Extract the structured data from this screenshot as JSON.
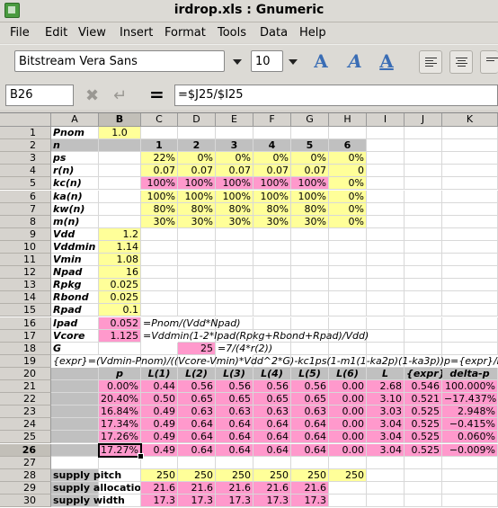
{
  "window": {
    "title": "irdrop.xls : Gnumeric"
  },
  "menu": [
    "File",
    "Edit",
    "View",
    "Insert",
    "Format",
    "Tools",
    "Data",
    "Help"
  ],
  "toolbar": {
    "font_name": "Bitstream Vera Sans",
    "font_size": "10"
  },
  "formula_bar": {
    "cell_ref": "B26",
    "equals": "=",
    "formula": "=$J25/$I25"
  },
  "columns": [
    "A",
    "B",
    "C",
    "D",
    "E",
    "F",
    "G",
    "H",
    "I",
    "J",
    "K"
  ],
  "rows": [
    "1",
    "2",
    "3",
    "4",
    "5",
    "6",
    "7",
    "8",
    "9",
    "10",
    "11",
    "12",
    "13",
    "14",
    "15",
    "16",
    "17",
    "18",
    "19",
    "20",
    "21",
    "22",
    "23",
    "24",
    "25",
    "26",
    "27",
    "28",
    "29",
    "30"
  ],
  "cells": {
    "r1": {
      "a": "Pnom",
      "b": "1.0"
    },
    "r2": {
      "a": "n",
      "c": "1",
      "d": "2",
      "e": "3",
      "f": "4",
      "g": "5",
      "h": "6"
    },
    "r3": {
      "a": "ps",
      "c": "22%",
      "d": "0%",
      "e": "0%",
      "f": "0%",
      "g": "0%",
      "h": "0%"
    },
    "r4": {
      "a": "r(n)",
      "c": "0.07",
      "d": "0.07",
      "e": "0.07",
      "f": "0.07",
      "g": "0.07",
      "h": "0"
    },
    "r5": {
      "a": "kc(n)",
      "c": "100%",
      "d": "100%",
      "e": "100%",
      "f": "100%",
      "g": "100%",
      "h": "0%"
    },
    "r6": {
      "a": "ka(n)",
      "c": "100%",
      "d": "100%",
      "e": "100%",
      "f": "100%",
      "g": "100%",
      "h": "0%"
    },
    "r7": {
      "a": "kw(n)",
      "c": "80%",
      "d": "80%",
      "e": "80%",
      "f": "80%",
      "g": "80%",
      "h": "0%"
    },
    "r8": {
      "a": "m(n)",
      "c": "30%",
      "d": "30%",
      "e": "30%",
      "f": "30%",
      "g": "30%",
      "h": "0%"
    },
    "r9": {
      "a": "Vdd",
      "b": "1.2"
    },
    "r10": {
      "a": "Vddmin",
      "b": "1.14"
    },
    "r11": {
      "a": "Vmin",
      "b": "1.08"
    },
    "r12": {
      "a": "Npad",
      "b": "16"
    },
    "r13": {
      "a": "Rpkg",
      "b": "0.025"
    },
    "r14": {
      "a": "Rbond",
      "b": "0.025"
    },
    "r15": {
      "a": "Rpad",
      "b": "0.1"
    },
    "r16": {
      "a": "Ipad",
      "b": "0.052",
      "c": "=Pnom/(Vdd*Npad)"
    },
    "r17": {
      "a": "Vcore",
      "b": "1.125",
      "c": "=Vddmin(1-2*Ipad(Rpkg+Rbond+Rpad)/Vdd)"
    },
    "r18": {
      "a": "G",
      "d": "25",
      "e": "=7/(4*r(2))"
    },
    "r19": {
      "a": "{expr}=(Vdmin-Pnom)/((Vcore-Vmin)*Vdd^2*G)-kc1ps(1-m1(1-ka2p)(1-ka3p))",
      "k": "p={expr}/L"
    },
    "r20": {
      "b": "p",
      "c": "L(1)",
      "d": "L(2)",
      "e": "L(3)",
      "f": "L(4)",
      "g": "L(5)",
      "h": "L(6)",
      "i": "L",
      "j": "{expr}",
      "k": "delta-p"
    },
    "r21": {
      "b": "0.00%",
      "c": "0.44",
      "d": "0.56",
      "e": "0.56",
      "f": "0.56",
      "g": "0.56",
      "h": "0.00",
      "i": "2.68",
      "j": "0.546",
      "k": "100.000%"
    },
    "r22": {
      "b": "20.40%",
      "c": "0.50",
      "d": "0.65",
      "e": "0.65",
      "f": "0.65",
      "g": "0.65",
      "h": "0.00",
      "i": "3.10",
      "j": "0.521",
      "k": "−17.437%"
    },
    "r23": {
      "b": "16.84%",
      "c": "0.49",
      "d": "0.63",
      "e": "0.63",
      "f": "0.63",
      "g": "0.63",
      "h": "0.00",
      "i": "3.03",
      "j": "0.525",
      "k": "2.948%"
    },
    "r24": {
      "b": "17.34%",
      "c": "0.49",
      "d": "0.64",
      "e": "0.64",
      "f": "0.64",
      "g": "0.64",
      "h": "0.00",
      "i": "3.04",
      "j": "0.525",
      "k": "−0.415%"
    },
    "r25": {
      "b": "17.26%",
      "c": "0.49",
      "d": "0.64",
      "e": "0.64",
      "f": "0.64",
      "g": "0.64",
      "h": "0.00",
      "i": "3.04",
      "j": "0.525",
      "k": "0.060%"
    },
    "r26": {
      "b": "17.27%",
      "c": "0.49",
      "d": "0.64",
      "e": "0.64",
      "f": "0.64",
      "g": "0.64",
      "h": "0.00",
      "i": "3.04",
      "j": "0.525",
      "k": "−0.009%"
    },
    "r28": {
      "a": "supply pitch",
      "c": "250",
      "d": "250",
      "e": "250",
      "f": "250",
      "g": "250",
      "h": "250"
    },
    "r29": {
      "a": "supply allocation",
      "c": "21.6",
      "d": "21.6",
      "e": "21.6",
      "f": "21.6",
      "g": "21.6"
    },
    "r30": {
      "a": "supply width",
      "c": "17.3",
      "d": "17.3",
      "e": "17.3",
      "f": "17.3",
      "g": "17.3"
    }
  }
}
